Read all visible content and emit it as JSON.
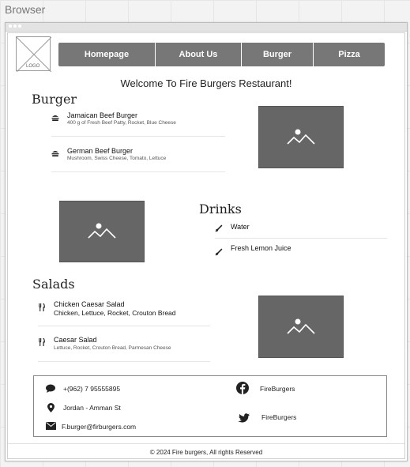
{
  "canvas_label": "Browser",
  "logo_text": "LOGO",
  "nav": [
    "Homepage",
    "About Us",
    "Burger",
    "Pizza"
  ],
  "welcome": "Welcome To Fire Burgers Restaurant!",
  "burger": {
    "title": "Burger",
    "items": [
      {
        "name": "Jamaican Beef Burger",
        "desc": "400 g of Fresh Beef Patty, Rocket, Blue Cheese"
      },
      {
        "name": "German Beef Burger",
        "desc": "Mushroom, Swiss Cheese, Tomato, Lettuce"
      }
    ]
  },
  "drinks": {
    "title": "Drinks",
    "items": [
      {
        "name": "Water"
      },
      {
        "name": "Fresh Lemon Juice"
      }
    ]
  },
  "salads": {
    "title": "Salads",
    "items": [
      {
        "name": "Chicken Caesar Salad",
        "desc": "Chicken, Lettuce, Rocket, Crouton Bread"
      },
      {
        "name": "Caesar Salad",
        "desc": "Lettuce, Rocket, Crouton Bread, Parmesan Cheese"
      }
    ]
  },
  "contact": {
    "phone": "+(962) 7 95555895",
    "location": "Jordan - Amman St",
    "email": "F.burger@firburgers.com",
    "facebook": "FireBurgers",
    "twitter": "FireBurgers"
  },
  "copyright": "© 2024 Fire burgers, All rights Reserved",
  "colors": {
    "nav_bg": "#777777",
    "image_placeholder": "#666666"
  }
}
